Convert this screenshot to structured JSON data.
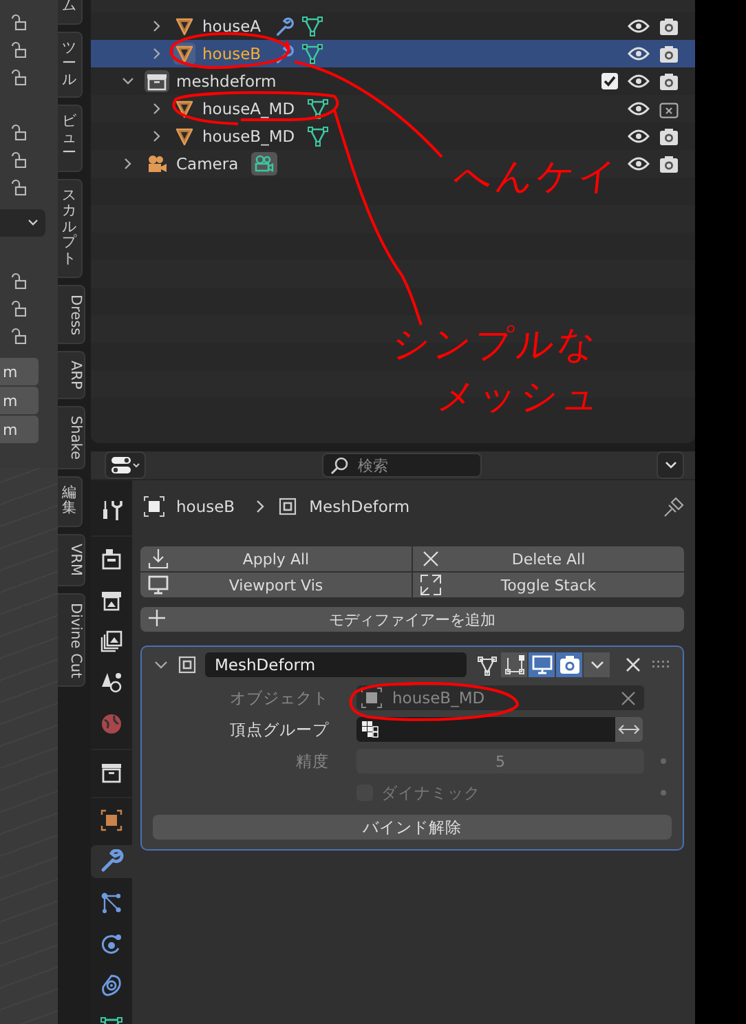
{
  "viewport_panel": {
    "fields": [
      "m",
      "m",
      "m"
    ]
  },
  "sidebar_tabs": [
    {
      "label": "ム",
      "kind": "cjk"
    },
    {
      "label": "ツール",
      "kind": "cjk"
    },
    {
      "label": "ビュー",
      "kind": "cjk"
    },
    {
      "label": "スカルプト",
      "kind": "cjk"
    },
    {
      "label": "Dress",
      "kind": "latin"
    },
    {
      "label": "ARP",
      "kind": "latin"
    },
    {
      "label": "Shake",
      "kind": "latin"
    },
    {
      "label": "編集",
      "kind": "cjk"
    },
    {
      "label": "VRM",
      "kind": "latin"
    },
    {
      "label": "Divine Cut",
      "kind": "latin"
    }
  ],
  "outliner": {
    "clipped_children": [
      {
        "name": "houseA",
        "kind": "mesh",
        "expanded": false,
        "selected": false,
        "modifier": true,
        "render": true
      },
      {
        "name": "houseB",
        "kind": "mesh",
        "expanded": false,
        "selected": true,
        "modifier": true,
        "render": true
      }
    ],
    "items": [
      {
        "name": "meshdeform",
        "kind": "collection",
        "expanded": true,
        "selected": false,
        "checked": true,
        "render": true,
        "children": [
          {
            "name": "houseA_MD",
            "kind": "mesh",
            "expanded": false,
            "selected": false,
            "modifier": false,
            "render": false
          },
          {
            "name": "houseB_MD",
            "kind": "mesh",
            "expanded": false,
            "selected": false,
            "modifier": false,
            "render": true
          }
        ]
      },
      {
        "name": "Camera",
        "kind": "camera",
        "expanded": false,
        "selected": false,
        "modifier": false,
        "render": true
      }
    ]
  },
  "properties": {
    "search": {
      "placeholder": "検索"
    },
    "breadcrumb": [
      "houseB",
      "MeshDeform"
    ],
    "tab_groups": [
      {
        "tabs": [
          {
            "kind": "tool",
            "selected": false
          }
        ]
      },
      {
        "tabs": [
          {
            "kind": "render",
            "selected": false
          },
          {
            "kind": "output",
            "selected": false
          },
          {
            "kind": "view_layer",
            "selected": false
          },
          {
            "kind": "scene",
            "selected": false
          },
          {
            "kind": "world",
            "selected": false
          }
        ]
      },
      {
        "tabs": [
          {
            "kind": "collection",
            "selected": false
          }
        ]
      },
      {
        "tabs": [
          {
            "kind": "object",
            "selected": false
          },
          {
            "kind": "modifiers",
            "selected": true
          },
          {
            "kind": "particles",
            "selected": false
          },
          {
            "kind": "physics",
            "selected": false
          },
          {
            "kind": "constraints",
            "selected": false
          },
          {
            "kind": "data",
            "selected": false
          }
        ]
      }
    ],
    "operators": [
      "Apply All",
      "Delete All",
      "Viewport Vis",
      "Toggle Stack"
    ],
    "add_modifier": "モディファイアーを追加",
    "modifier": {
      "name": "MeshDeform",
      "expanded": true,
      "toggles": [
        {
          "kind": "editmode",
          "on": false
        },
        {
          "kind": "cage",
          "on": false
        },
        {
          "kind": "viewport",
          "on": true
        },
        {
          "kind": "render",
          "on": true
        }
      ],
      "object": {
        "label": "オブジェクト",
        "value": "houseB_MD",
        "disabled": true
      },
      "vertex_group": {
        "label": "頂点グループ"
      },
      "precision": {
        "label": "精度",
        "value": "5",
        "disabled": true
      },
      "dynamic": {
        "label": "ダイナミック",
        "checked": false,
        "disabled": true
      },
      "unbind": "バインド解除"
    }
  },
  "annotations": {
    "notes": [
      "へんケイ",
      "シンプルな",
      "メッシュ"
    ]
  }
}
